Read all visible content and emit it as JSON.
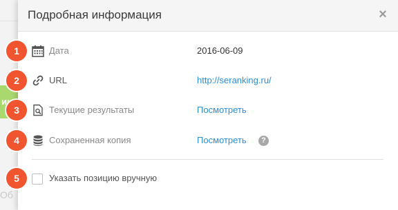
{
  "background": {
    "green_text": "ин",
    "bottom_text": "Об"
  },
  "dialog": {
    "title": "Подробная информация",
    "close_label": "×",
    "rows": [
      {
        "icon": "calendar-icon",
        "label": "Дата",
        "value": "2016-06-09"
      },
      {
        "icon": "link-icon",
        "label": "URL",
        "value": "http://seranking.ru/"
      },
      {
        "icon": "search-document-icon",
        "label": "Текущие результаты",
        "value": "Посмотреть"
      },
      {
        "icon": "database-icon",
        "label": "Сохраненная копия",
        "value": "Посмотреть",
        "help": "?"
      }
    ],
    "manual_position": {
      "label": "Указать позицию вручную",
      "checked": false
    }
  },
  "badges": [
    "1",
    "2",
    "3",
    "4",
    "5"
  ],
  "colors": {
    "badge": "#f0552f",
    "link": "#2b8fd6",
    "header_bg": "#f5f5f5"
  }
}
